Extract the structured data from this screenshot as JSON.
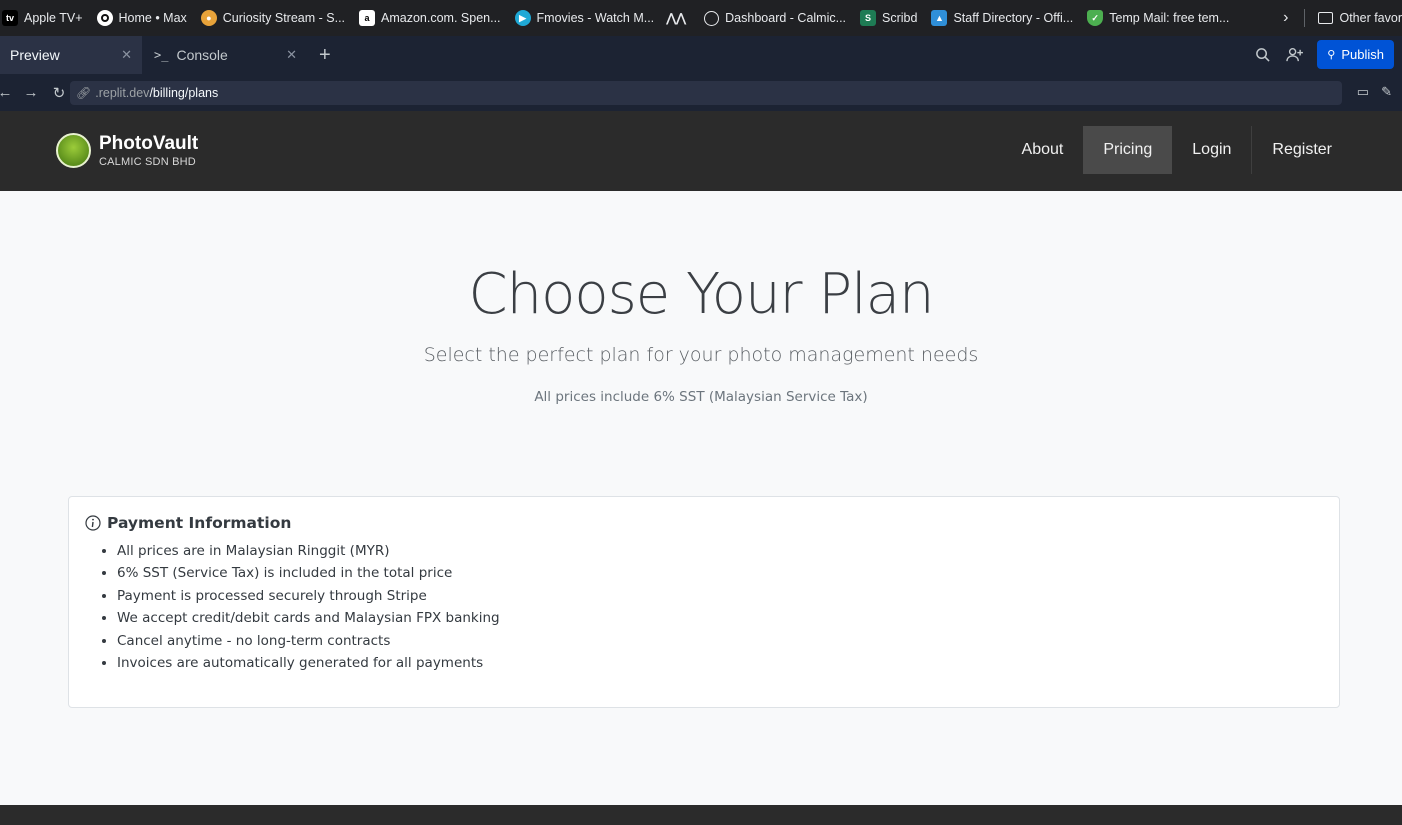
{
  "bookmarks": [
    {
      "label": "Apple TV+",
      "icon": "apple-tv-icon",
      "color": "#000000"
    },
    {
      "label": "Home • Max",
      "icon": "max-icon",
      "color": "#111111"
    },
    {
      "label": "Curiosity Stream - S...",
      "icon": "curiosity-stream-icon",
      "color": "#e8a33a"
    },
    {
      "label": "Amazon.com. Spen...",
      "icon": "amazon-icon",
      "color": "#ffffff"
    },
    {
      "label": "Fmovies - Watch M...",
      "icon": "fmovies-icon",
      "color": "#1fa9d6"
    },
    {
      "label": "",
      "icon": "wave-icon",
      "color": "#202124"
    },
    {
      "label": "Dashboard - Calmic...",
      "icon": "globe-icon",
      "color": "#202124"
    },
    {
      "label": "Scribd",
      "icon": "scribd-icon",
      "color": "#1e7b54"
    },
    {
      "label": "Staff Directory - Offi...",
      "icon": "staff-directory-icon",
      "color": "#2f8fd8"
    },
    {
      "label": "Temp Mail: free tem...",
      "icon": "shield-check-icon",
      "color": "#4caf50"
    }
  ],
  "bookmarks_other": "Other favor",
  "tabs": {
    "preview": "Preview",
    "console": "Console"
  },
  "toolbar": {
    "publish_label": "Publish"
  },
  "address": {
    "domain": ".replit.dev",
    "path": "/billing/plans"
  },
  "site": {
    "brand_name": "PhotoVault",
    "brand_sub": "CALMIC SDN BHD",
    "nav": [
      "About",
      "Pricing",
      "Login",
      "Register"
    ],
    "active_nav": "Pricing"
  },
  "hero": {
    "title": "Choose Your Plan",
    "subtitle": "Select the perfect plan for your photo management needs",
    "note": "All prices include 6% SST (Malaysian Service Tax)"
  },
  "payment_info": {
    "title": "Payment Information",
    "items": [
      "All prices are in Malaysian Ringgit (MYR)",
      "6% SST (Service Tax) is included in the total price",
      "Payment is processed securely through Stripe",
      "We accept credit/debit cards and Malaysian FPX banking",
      "Cancel anytime - no long-term contracts",
      "Invoices are automatically generated for all payments"
    ]
  },
  "colors": {
    "navbar": "#2b2b2b",
    "page_bg": "#f8f9fa",
    "publish": "#0053d6"
  }
}
